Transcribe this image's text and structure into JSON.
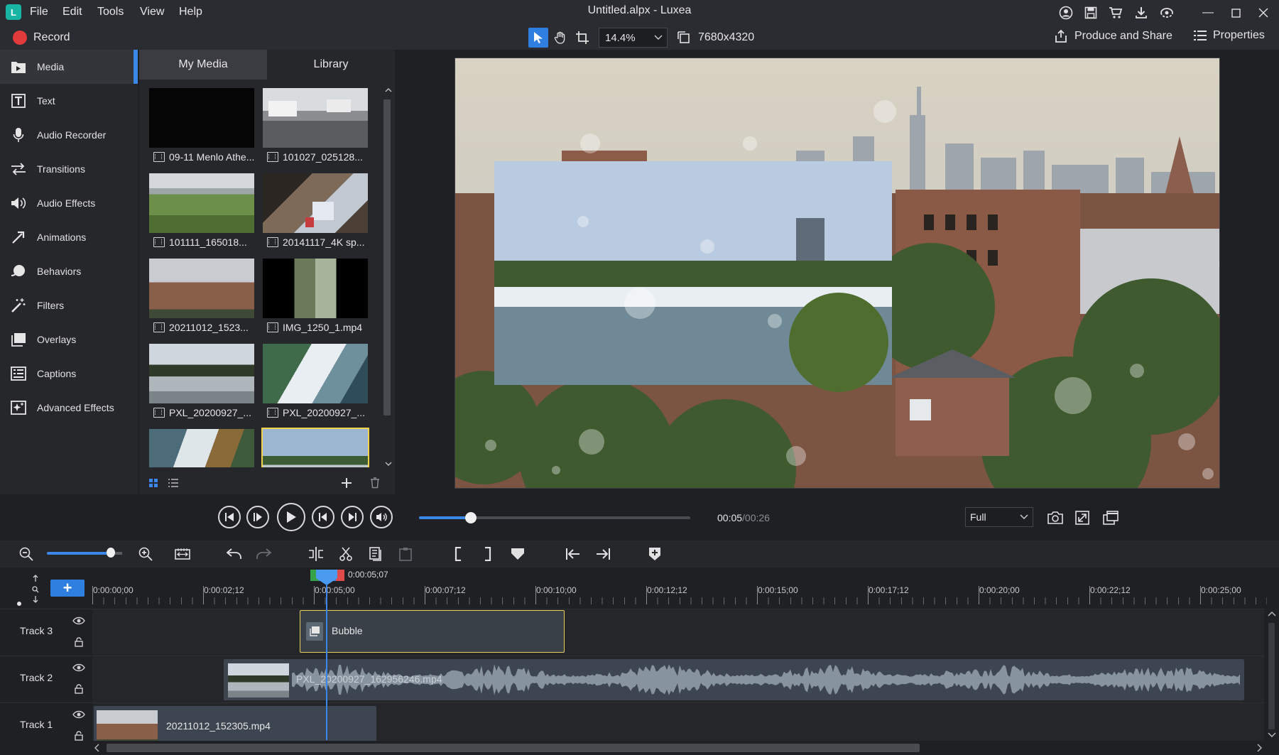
{
  "app": {
    "window_title": "Untitled.alpx - Luxea",
    "menu": [
      "File",
      "Edit",
      "Tools",
      "View",
      "Help"
    ]
  },
  "toolbar": {
    "record_label": "Record",
    "zoom_value": "14.4%",
    "resolution": "7680x4320",
    "produce_label": "Produce and Share",
    "properties_label": "Properties"
  },
  "sidebar": {
    "items": [
      {
        "label": "Media",
        "icon": "media-folder-icon",
        "active": true
      },
      {
        "label": "Text",
        "icon": "text-icon",
        "active": false
      },
      {
        "label": "Audio Recorder",
        "icon": "microphone-icon",
        "active": false
      },
      {
        "label": "Transitions",
        "icon": "transitions-icon",
        "active": false
      },
      {
        "label": "Audio Effects",
        "icon": "speaker-icon",
        "active": false
      },
      {
        "label": "Animations",
        "icon": "animation-arrow-icon",
        "active": false
      },
      {
        "label": "Behaviors",
        "icon": "behaviors-icon",
        "active": false
      },
      {
        "label": "Filters",
        "icon": "magic-wand-icon",
        "active": false
      },
      {
        "label": "Overlays",
        "icon": "overlays-icon",
        "active": false
      },
      {
        "label": "Captions",
        "icon": "captions-icon",
        "active": false
      },
      {
        "label": "Advanced Effects",
        "icon": "sparkle-icon",
        "active": false
      }
    ]
  },
  "media_panel": {
    "tabs": [
      "My Media",
      "Library"
    ],
    "active_tab": "My Media",
    "items": [
      {
        "label": "09-11 Menlo Athe...",
        "thumb": "black"
      },
      {
        "label": "101027_025128...",
        "thumb": "street"
      },
      {
        "label": "101111_165018...",
        "thumb": "mountain"
      },
      {
        "label": "20141117_4K sp...",
        "thumb": "interior"
      },
      {
        "label": "20211012_1523...",
        "thumb": "city"
      },
      {
        "label": "IMG_1250_1.mp4",
        "thumb": "forest"
      },
      {
        "label": "PXL_20200927_...",
        "thumb": "river"
      },
      {
        "label": "PXL_20200927_...",
        "thumb": "waterfall"
      },
      {
        "label": "",
        "thumb": "falls"
      },
      {
        "label": "",
        "thumb": "horizon",
        "selected": true
      }
    ]
  },
  "playback": {
    "current_time": "00:05",
    "total_time": "/00:26",
    "quality": "Full",
    "progress_fraction": 0.19
  },
  "timeline": {
    "playhead_time": "0:00:05;07",
    "ruler_labels": [
      "0:00:00;00",
      "0:00:02;12",
      "0:00:05;00",
      "0:00:07;12",
      "0:00:10;00",
      "0:00:12;12",
      "0:00:15;00",
      "0:00:17;12",
      "0:00:20;00",
      "0:00:22;12",
      "0:00:25;00"
    ],
    "tracks": [
      {
        "name": "Track 3",
        "clip_label": "Bubble"
      },
      {
        "name": "Track 2",
        "clip_label": "PXL_20200927_162956246.mp4"
      },
      {
        "name": "Track 1",
        "clip_label": "20211012_152305.mp4"
      }
    ]
  },
  "colors": {
    "accent": "#3a87e8",
    "record": "#e13b3b",
    "selection": "#f1d24a",
    "background": "#1f2024"
  }
}
